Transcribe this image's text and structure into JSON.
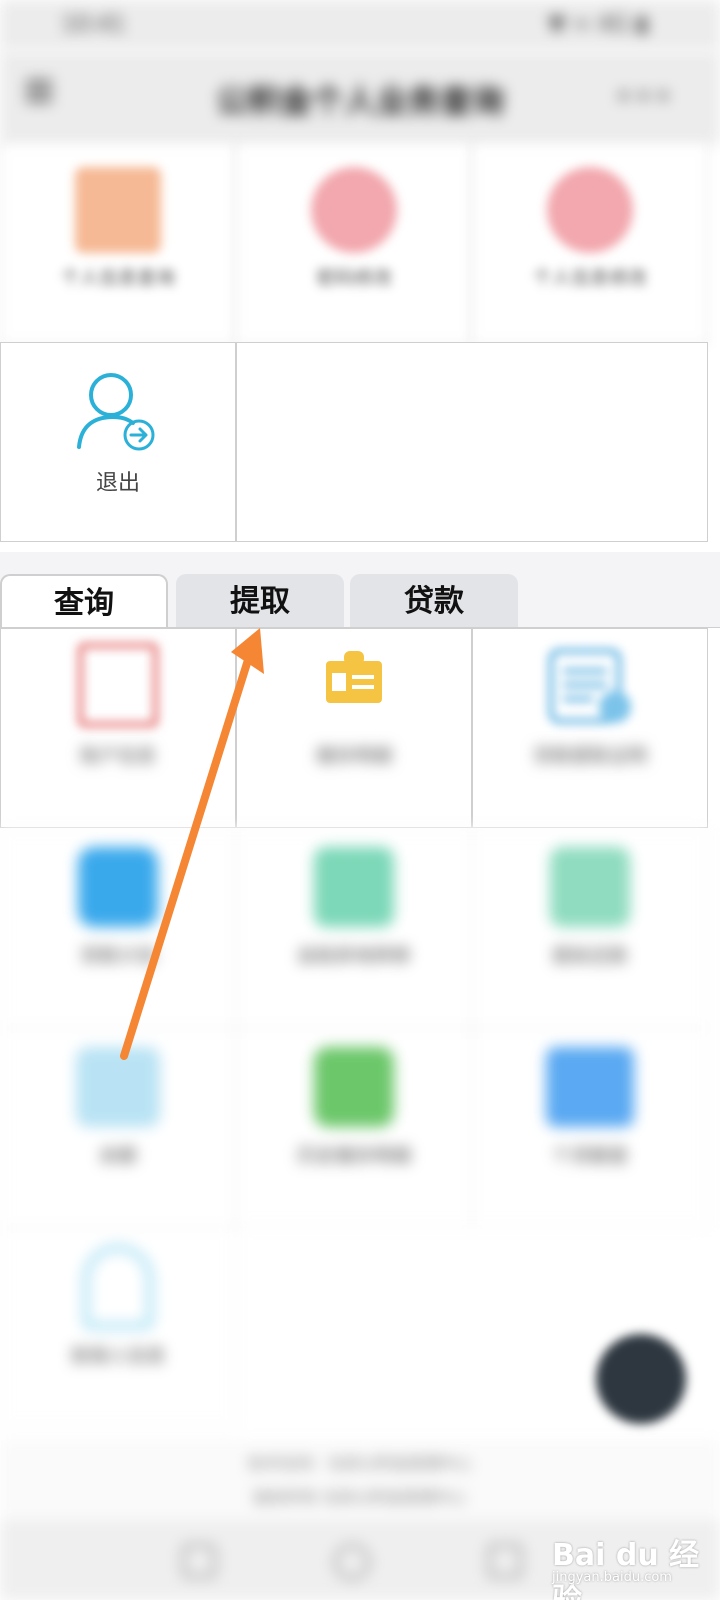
{
  "status_bar": {
    "time": "10:41",
    "right": "▼ ≈ 4G ▮"
  },
  "header": {
    "title": "公积金个人业务查询",
    "more": "•••"
  },
  "top_grid": {
    "items": [
      {
        "label": "个人信息查询",
        "icon": "id-card-icon"
      },
      {
        "label": "密码修改",
        "icon": "key-icon"
      },
      {
        "label": "个人信息修改",
        "icon": "edit-icon"
      }
    ],
    "logout_label": "退出"
  },
  "tabs": [
    {
      "label": "查询",
      "active": true
    },
    {
      "label": "提取",
      "active": false
    },
    {
      "label": "贷款",
      "active": false
    }
  ],
  "query_grid": {
    "items": [
      {
        "label": "账户信息"
      },
      {
        "label": "缴存明细"
      },
      {
        "label": "贷款提取证明"
      },
      {
        "label": "贷款计划"
      },
      {
        "label": "自助异地转移"
      },
      {
        "label": "提前还款"
      },
      {
        "label": "余额"
      },
      {
        "label": "历史缴存明细"
      },
      {
        "label": "个贷额度"
      },
      {
        "label": "担保人信息"
      }
    ]
  },
  "footer": {
    "line1": "技术支持：住房公积金管理中心",
    "line2": "版权所有 住房公积金管理中心"
  },
  "watermark": {
    "brand": "Bai du 经验",
    "url": "jingyan.baidu.com"
  },
  "colors": {
    "accent": "#2bb0d8",
    "arrow": "#f58634"
  }
}
